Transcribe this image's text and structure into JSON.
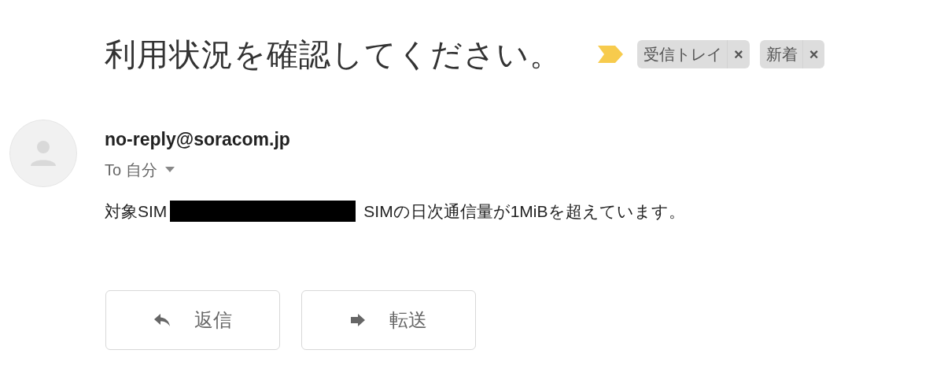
{
  "subject": "利用状況を確認してください。",
  "important": true,
  "labels": [
    {
      "name": "受信トレイ",
      "remove": "×"
    },
    {
      "name": "新着",
      "remove": "×"
    }
  ],
  "sender": "no-reply@soracom.jp",
  "recipient": {
    "prefix": "To",
    "name": "自分"
  },
  "body": {
    "before": "対象SIM",
    "redacted": true,
    "after": "SIMの日次通信量が1MiBを超えています。"
  },
  "actions": [
    {
      "kind": "reply",
      "label": "返信"
    },
    {
      "kind": "forward",
      "label": "転送"
    }
  ]
}
